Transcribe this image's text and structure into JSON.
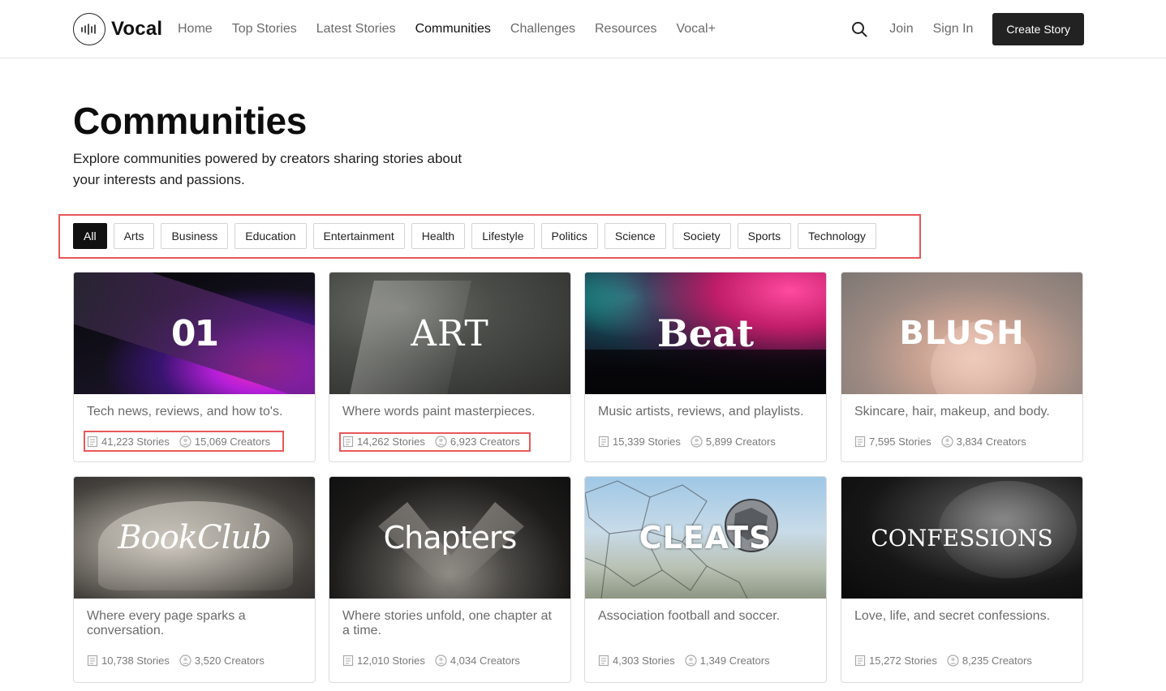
{
  "brand": {
    "name": "Vocal"
  },
  "nav": [
    "Home",
    "Top Stories",
    "Latest Stories",
    "Communities",
    "Challenges",
    "Resources",
    "Vocal+"
  ],
  "nav_active": "Communities",
  "header": {
    "join": "Join",
    "sign_in": "Sign In",
    "create": "Create Story",
    "search_icon": "search-icon"
  },
  "page": {
    "title": "Communities",
    "description": "Explore communities powered by creators sharing stories about your interests and passions."
  },
  "filters": [
    "All",
    "Arts",
    "Business",
    "Education",
    "Entertainment",
    "Health",
    "Lifestyle",
    "Politics",
    "Science",
    "Society",
    "Sports",
    "Technology"
  ],
  "filter_active": "All",
  "communities": [
    {
      "logo": "01",
      "description": "Tech news, reviews, and how to's.",
      "stories": "41,223 Stories",
      "creators": "15,069 Creators"
    },
    {
      "logo": "ART",
      "description": "Where words paint masterpieces.",
      "stories": "14,262 Stories",
      "creators": "6,923 Creators"
    },
    {
      "logo": "Beat",
      "description": "Music artists, reviews, and playlists.",
      "stories": "15,339 Stories",
      "creators": "5,899 Creators"
    },
    {
      "logo": "BLUSH",
      "description": "Skincare, hair, makeup, and body.",
      "stories": "7,595 Stories",
      "creators": "3,834 Creators"
    },
    {
      "logo": "BookClub",
      "description": "Where every page sparks a conversation.",
      "stories": "10,738 Stories",
      "creators": "3,520 Creators"
    },
    {
      "logo": "Chapters",
      "description": "Where stories unfold, one chapter at a time.",
      "stories": "12,010 Stories",
      "creators": "4,034 Creators"
    },
    {
      "logo": "CLEATS",
      "description": "Association football and soccer.",
      "stories": "4,303 Stories",
      "creators": "1,349 Creators"
    },
    {
      "logo": "CONFESSIONS",
      "description": "Love, life, and secret confessions.",
      "stories": "15,272 Stories",
      "creators": "8,235 Creators"
    }
  ],
  "colors": {
    "highlight": "#e8585a",
    "button": "#222222",
    "muted_text": "#6b6b6b"
  }
}
